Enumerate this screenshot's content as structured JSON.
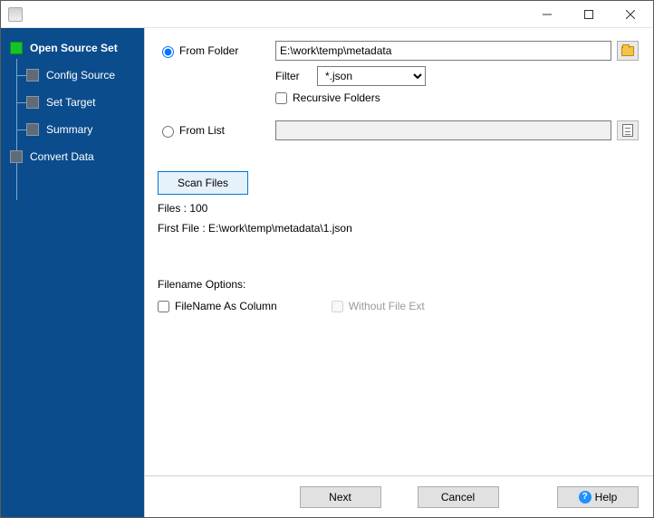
{
  "sidebar": {
    "items": [
      {
        "label": "Open Source Set",
        "active": true,
        "level": 0
      },
      {
        "label": "Config Source",
        "active": false,
        "level": 1
      },
      {
        "label": "Set Target",
        "active": false,
        "level": 1
      },
      {
        "label": "Summary",
        "active": false,
        "level": 1
      },
      {
        "label": "Convert Data",
        "active": false,
        "level": 0
      }
    ]
  },
  "source": {
    "from_folder_label": "From Folder",
    "folder_path": "E:\\work\\temp\\metadata",
    "filter_label": "Filter",
    "filter_value": "*.json",
    "recursive_label": "Recursive Folders",
    "from_list_label": "From List",
    "list_path": ""
  },
  "scan": {
    "button_label": "Scan Files",
    "files_label": "Files : 100",
    "first_file_label": "First File : E:\\work\\temp\\metadata\\1.json"
  },
  "filename_options": {
    "heading": "Filename Options:",
    "as_column_label": "FileName As Column",
    "without_ext_label": "Without File Ext"
  },
  "footer": {
    "next": "Next",
    "cancel": "Cancel",
    "help": "Help"
  }
}
